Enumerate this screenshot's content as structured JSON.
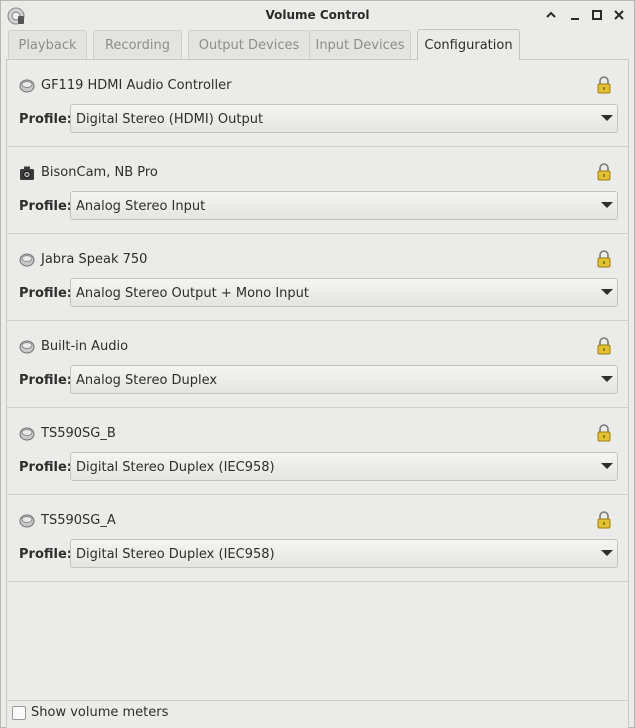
{
  "window": {
    "title": "Volume Control"
  },
  "tabs": [
    {
      "label": "Playback"
    },
    {
      "label": "Recording"
    },
    {
      "label": "Output Devices"
    },
    {
      "label": "Input Devices"
    },
    {
      "label": "Configuration"
    }
  ],
  "profile_label": "Profile:",
  "devices": [
    {
      "name": "GF119 HDMI Audio Controller",
      "icon": "speaker-icon",
      "profile": "Digital Stereo (HDMI) Output"
    },
    {
      "name": "BisonCam, NB Pro",
      "icon": "camera-icon",
      "profile": "Analog Stereo Input"
    },
    {
      "name": "Jabra Speak 750",
      "icon": "speaker-icon",
      "profile": "Analog Stereo Output + Mono Input"
    },
    {
      "name": "Built-in Audio",
      "icon": "speaker-icon",
      "profile": "Analog Stereo Duplex"
    },
    {
      "name": "TS590SG_B",
      "icon": "speaker-icon",
      "profile": "Digital Stereo Duplex (IEC958)"
    },
    {
      "name": "TS590SG_A",
      "icon": "speaker-icon",
      "profile": "Digital Stereo Duplex (IEC958)"
    }
  ],
  "footer": {
    "show_meters_label": "Show volume meters",
    "show_meters_checked": false
  },
  "colors": {
    "window_bg": "#ebebea",
    "lock_gold": "#d6b62a"
  }
}
